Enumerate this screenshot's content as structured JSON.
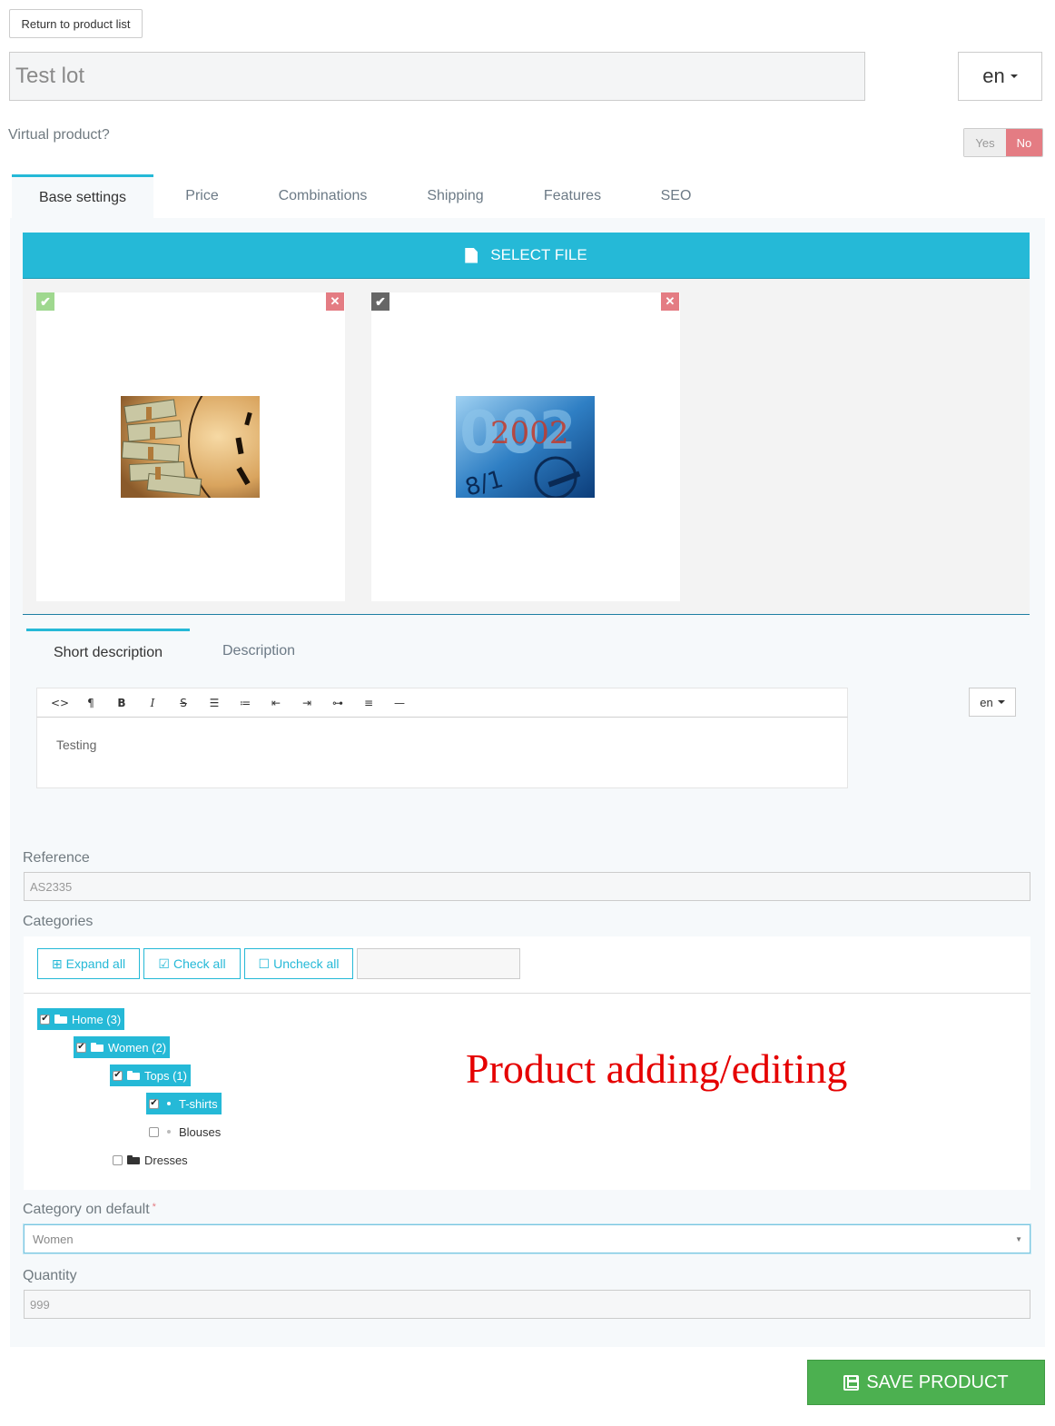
{
  "header": {
    "return_label": "Return to product list",
    "product_name": "Test lot",
    "language": "en"
  },
  "virtual": {
    "label": "Virtual product?",
    "yes_label": "Yes",
    "no_label": "No",
    "selected": "No"
  },
  "tabs": [
    {
      "label": "Base settings",
      "active": true
    },
    {
      "label": "Price"
    },
    {
      "label": "Combinations"
    },
    {
      "label": "Shipping"
    },
    {
      "label": "Features"
    },
    {
      "label": "SEO"
    }
  ],
  "images": {
    "select_file_label": "SELECT FILE",
    "items": [
      {
        "cover": true,
        "description": "money and clock photo"
      },
      {
        "cover": false,
        "description": "2002 calendar photo"
      }
    ]
  },
  "description_tabs": [
    {
      "label": "Short description",
      "active": true
    },
    {
      "label": "Description"
    }
  ],
  "editor": {
    "content": "Testing",
    "language": "en",
    "toolbar_icons": [
      "code-icon",
      "paragraph-icon",
      "bold-icon",
      "italic-icon",
      "strikethrough-icon",
      "bullet-list-icon",
      "numbered-list-icon",
      "outdent-icon",
      "indent-icon",
      "link-icon",
      "align-icon",
      "horizontal-rule-icon"
    ]
  },
  "reference": {
    "label": "Reference",
    "value": "AS2335"
  },
  "categories": {
    "label": "Categories",
    "expand_all": "Expand all",
    "check_all": "Check all",
    "uncheck_all": "Uncheck all",
    "search_value": "",
    "tree": [
      {
        "label": "Home (3)",
        "checked": true,
        "level": 0
      },
      {
        "label": "Women (2)",
        "checked": true,
        "level": 1
      },
      {
        "label": "Tops (1)",
        "checked": true,
        "level": 2
      },
      {
        "label": "T-shirts",
        "checked": true,
        "level": 3
      },
      {
        "label": "Blouses",
        "checked": false,
        "level": 3
      },
      {
        "label": "Dresses",
        "checked": false,
        "level": 2
      }
    ]
  },
  "overlay_caption": "Product adding/editing",
  "default_category": {
    "label": "Category on default",
    "required_mark": "*",
    "value": "Women"
  },
  "quantity": {
    "label": "Quantity",
    "value": "999"
  },
  "save_label": "SAVE PRODUCT",
  "colors": {
    "accent": "#25b9d7",
    "danger": "#e47c83",
    "success": "#4cb050",
    "caption": "#e50000"
  }
}
